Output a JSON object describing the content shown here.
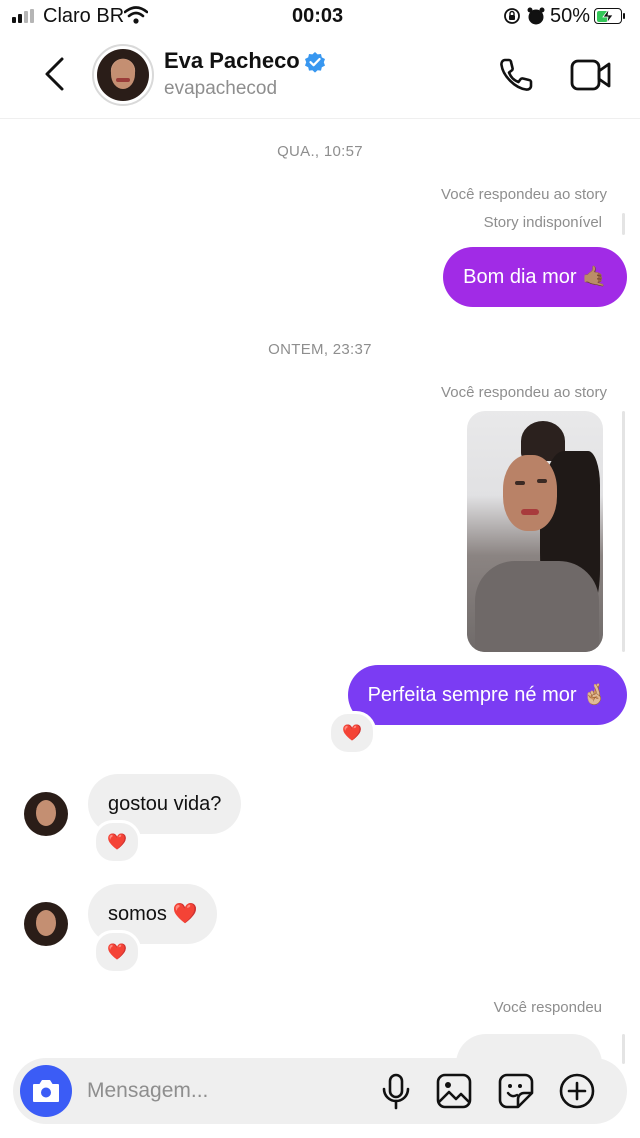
{
  "status_bar": {
    "carrier": "Claro BR",
    "time": "00:03",
    "battery_percent": "50%",
    "battery_level": 0.5
  },
  "header": {
    "name": "Eva Pacheco",
    "username": "evapachecod",
    "verified": true,
    "icons": [
      "back-icon",
      "verified-icon",
      "phone-icon",
      "video-icon"
    ]
  },
  "chat": {
    "ts1": "QUA., 10:57",
    "reply1_meta": "Você respondeu ao story",
    "reply1_sub": "Story indisponível",
    "msg1": "Bom dia mor 🤙🏽",
    "ts2": "ONTEM, 23:37",
    "reply2_meta": "Você respondeu ao story",
    "msg2": "Perfeita sempre né mor 🤞🏼",
    "msg2_reaction": "❤️",
    "in1": "gostou vida?",
    "in1_reaction": "❤️",
    "in2": "somos ❤️",
    "in2_reaction": "❤️",
    "reply3_meta": "Você respondeu"
  },
  "composer": {
    "placeholder": "Mensagem...",
    "icons": [
      "camera-icon",
      "microphone-icon",
      "gallery-icon",
      "sticker-icon",
      "add-icon"
    ]
  },
  "colors": {
    "bubble_purple_1": "#a02be8",
    "bubble_purple_2": "#7a3cf2",
    "camera_blue": "#3b5cf6",
    "verified_blue": "#3897f0",
    "meta_gray": "#8e8e8e"
  }
}
